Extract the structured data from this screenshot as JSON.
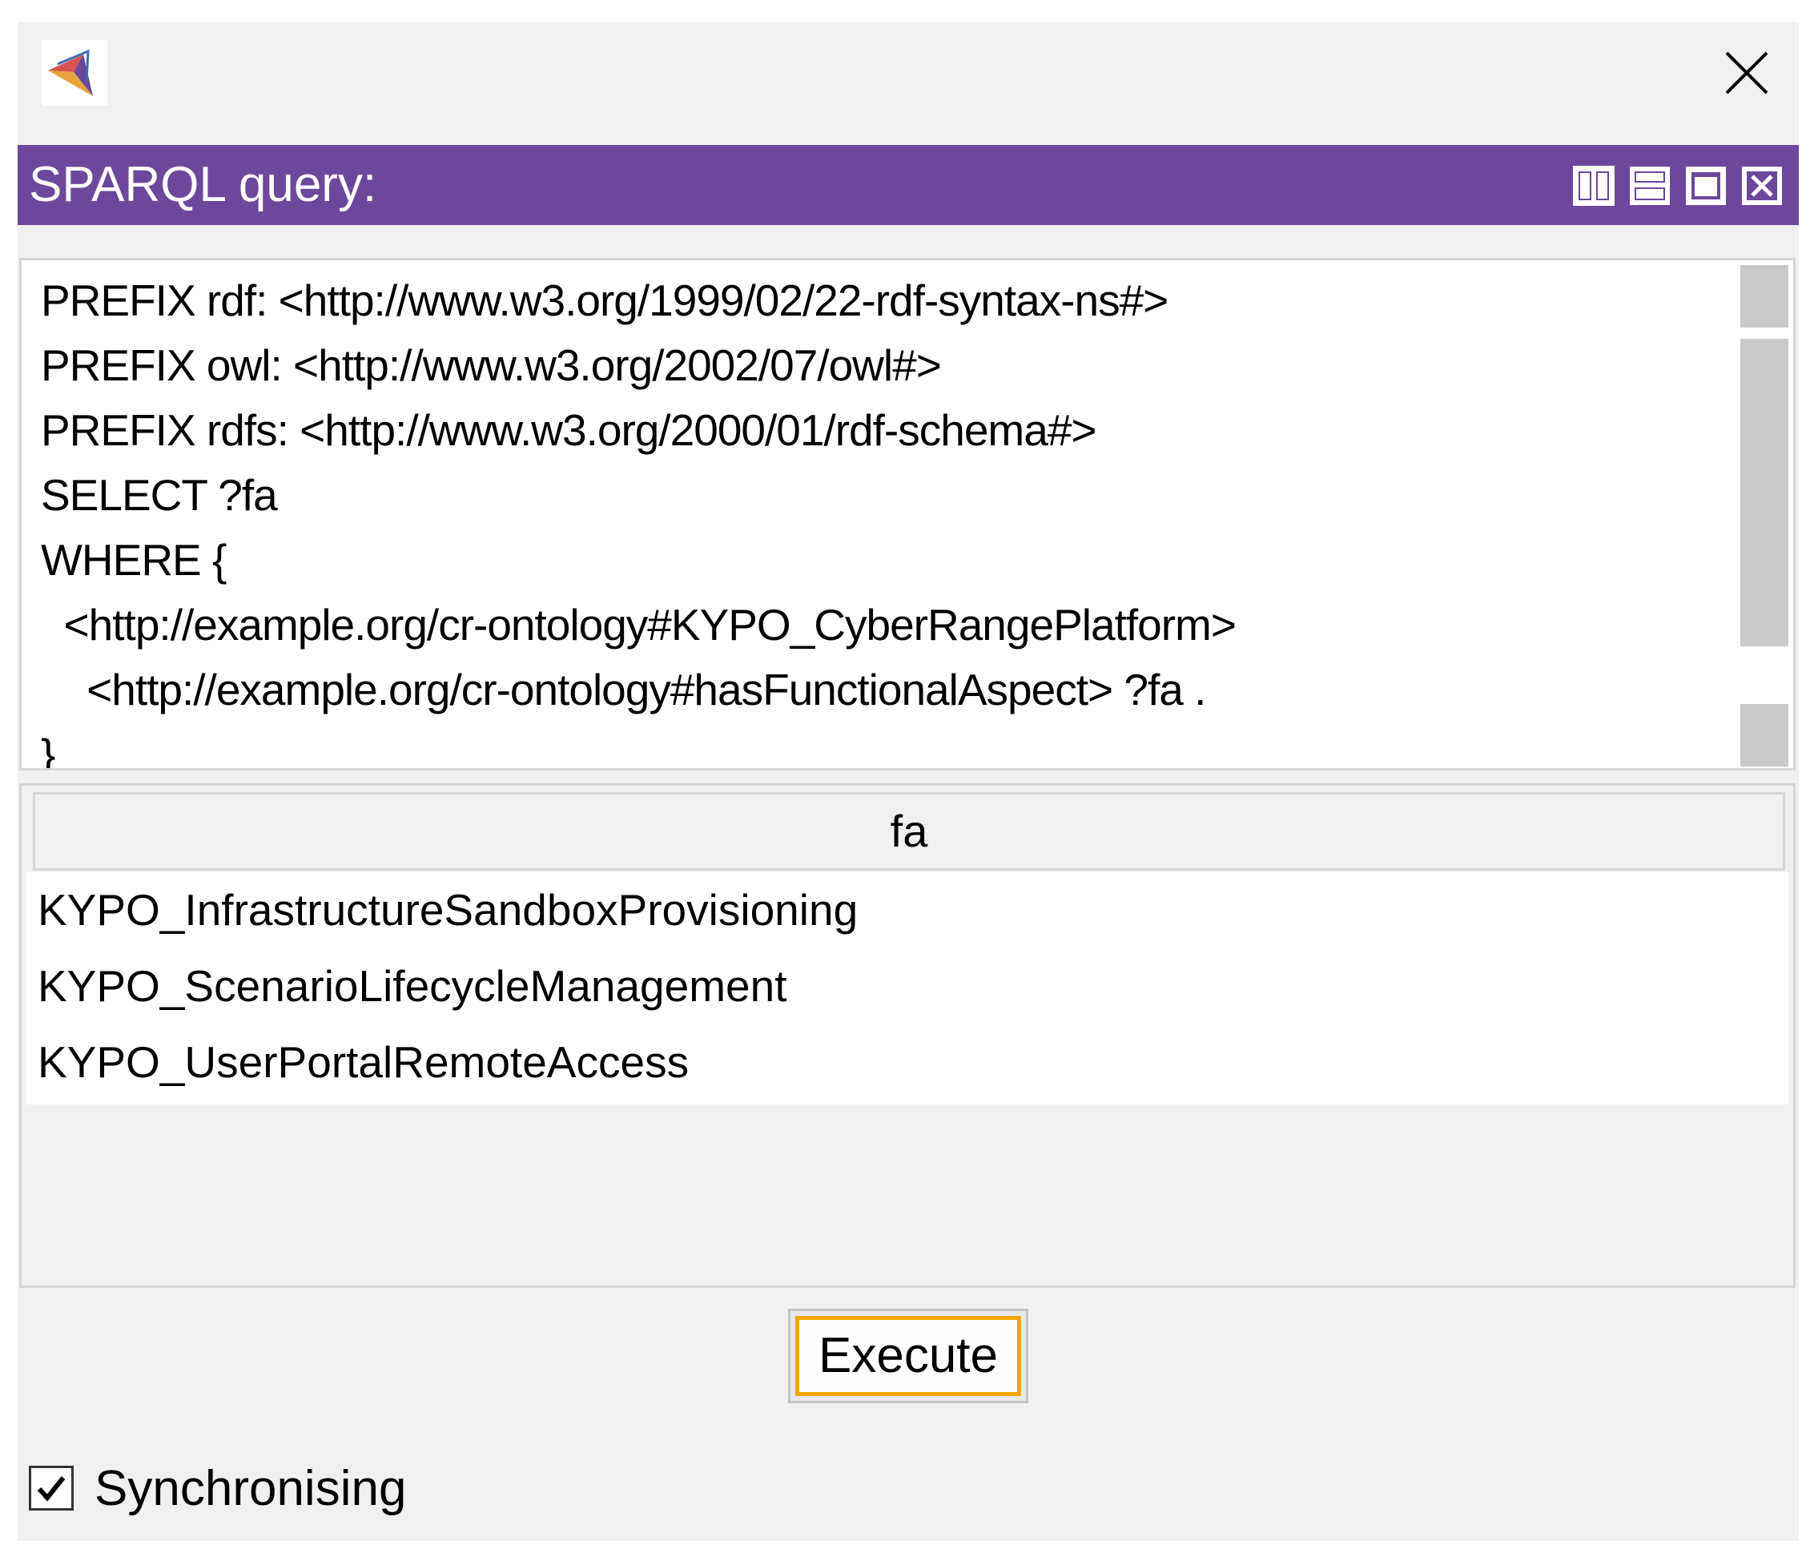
{
  "window": {
    "logo_icon": "protege-logo-icon",
    "close_icon": "close-icon"
  },
  "view": {
    "title": "SPARQL query:",
    "controls": [
      "split-vertical-icon",
      "split-horizontal-icon",
      "maximize-view-icon",
      "close-view-icon"
    ],
    "header_color": "#6c489c"
  },
  "query": {
    "text": "PREFIX rdf: <http://www.w3.org/1999/02/22-rdf-syntax-ns#>\nPREFIX owl: <http://www.w3.org/2002/07/owl#>\nPREFIX rdfs: <http://www.w3.org/2000/01/rdf-schema#>\nSELECT ?fa\nWHERE {\n  <http://example.org/cr-ontology#KYPO_CyberRangePlatform>\n    <http://example.org/cr-ontology#hasFunctionalAspect> ?fa .\n}"
  },
  "results": {
    "columns": [
      "fa"
    ],
    "rows": [
      "KYPO_InfrastructureSandboxProvisioning",
      "KYPO_ScenarioLifecycleManagement",
      "KYPO_UserPortalRemoteAccess"
    ]
  },
  "actions": {
    "execute_label": "Execute",
    "focus_color": "#f1a400"
  },
  "sync": {
    "label": "Synchronising",
    "checked": true
  }
}
